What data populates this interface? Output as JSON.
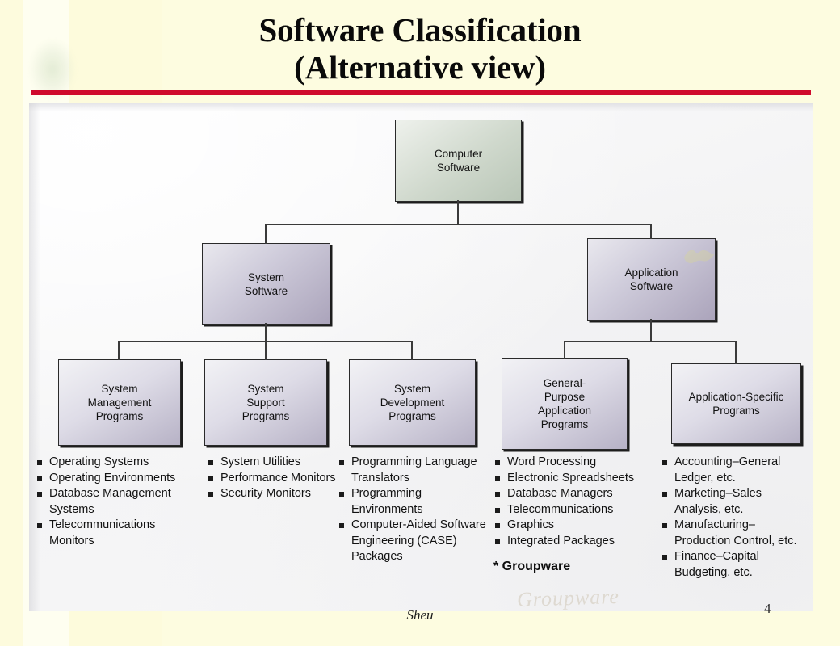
{
  "slide": {
    "title_line1": "Software Classification",
    "title_line2": "(Alternative view)",
    "accent_rule_color": "#cf0a2c",
    "background_color": "#fdfce2",
    "panel_color": "#f7f7f7",
    "footer_author": "Sheu",
    "page_number": "4",
    "ghost_annotation": "Groupware"
  },
  "chart_data": {
    "type": "diagram",
    "title": "Software Classification (Alternative view)",
    "diagram_kind": "hierarchy-tree",
    "levels": 3,
    "root": {
      "id": "computer-software",
      "label_lines": [
        "Computer",
        "Software"
      ],
      "fill": "#cfd8cc"
    },
    "level2": [
      {
        "id": "system-software",
        "label_lines": [
          "System",
          "Software"
        ],
        "fill": "#cfccdb"
      },
      {
        "id": "application-software",
        "label_lines": [
          "Application",
          "Software"
        ],
        "fill": "#cfccdb"
      }
    ],
    "level3": [
      {
        "id": "system-management-programs",
        "parent": "system-software",
        "label_lines": [
          "System",
          "Management",
          "Programs"
        ]
      },
      {
        "id": "system-support-programs",
        "parent": "system-software",
        "label_lines": [
          "System",
          "Support",
          "Programs"
        ]
      },
      {
        "id": "system-development-programs",
        "parent": "system-software",
        "label_lines": [
          "System",
          "Development",
          "Programs"
        ]
      },
      {
        "id": "general-purpose-application-programs",
        "parent": "application-software",
        "label_lines": [
          "General-",
          "Purpose",
          "Application",
          "Programs"
        ]
      },
      {
        "id": "application-specific-programs",
        "parent": "application-software",
        "label_lines": [
          "Application-Specific",
          "Programs"
        ]
      }
    ],
    "lists": [
      {
        "for": "system-management-programs",
        "items": [
          "Operating Systems",
          "Operating Environments",
          "Database Management Systems",
          "Telecommunications Monitors"
        ]
      },
      {
        "for": "system-support-programs",
        "items": [
          "System Utilities",
          "Performance Monitors",
          "Security Monitors"
        ]
      },
      {
        "for": "system-development-programs",
        "items": [
          "Programming Language Translators",
          "Programming Environments",
          "Computer-Aided Software Engineering (CASE) Packages"
        ]
      },
      {
        "for": "general-purpose-application-programs",
        "items": [
          "Word Processing",
          "Electronic Spreadsheets",
          "Database Managers",
          "Telecommunications",
          "Graphics",
          "Integrated Packages"
        ],
        "footnote": "* Groupware"
      },
      {
        "for": "application-specific-programs",
        "items": [
          "Accounting–General Ledger, etc.",
          "Marketing–Sales Analysis, etc.",
          "Manufacturing–Production Control, etc.",
          "Finance–Capital Budgeting, etc."
        ]
      }
    ]
  },
  "nodes": {
    "root": {
      "l1": "Computer",
      "l2": "Software"
    },
    "system_software": {
      "l1": "System",
      "l2": "Software"
    },
    "application_software": {
      "l1": "Application",
      "l2": "Software"
    },
    "system_management": {
      "l1": "System",
      "l2": "Management",
      "l3": "Programs"
    },
    "system_support": {
      "l1": "System",
      "l2": "Support",
      "l3": "Programs"
    },
    "system_development": {
      "l1": "System",
      "l2": "Development",
      "l3": "Programs"
    },
    "general_purpose": {
      "l1": "General-",
      "l2": "Purpose",
      "l3": "Application",
      "l4": "Programs"
    },
    "application_specific": {
      "l1": "Application-Specific",
      "l2": "Programs"
    }
  },
  "lists": {
    "col1": [
      "Operating Systems",
      "Operating Environments",
      "Database Management Systems",
      "Telecommunications Monitors"
    ],
    "col2": [
      "System Utilities",
      "Performance Monitors",
      "Security Monitors"
    ],
    "col3": [
      "Programming Language Translators",
      "Programming Environments",
      "Computer-Aided Software Engineering (CASE) Packages"
    ],
    "col4": [
      "Word Processing",
      "Electronic Spreadsheets",
      "Database Managers",
      "Telecommunications",
      "Graphics",
      "Integrated Packages"
    ],
    "col4_footnote": "* Groupware",
    "col5": [
      "Accounting–General Ledger, etc.",
      "Marketing–Sales Analysis, etc.",
      "Manufacturing–Production Control, etc.",
      "Finance–Capital Budgeting, etc."
    ]
  }
}
